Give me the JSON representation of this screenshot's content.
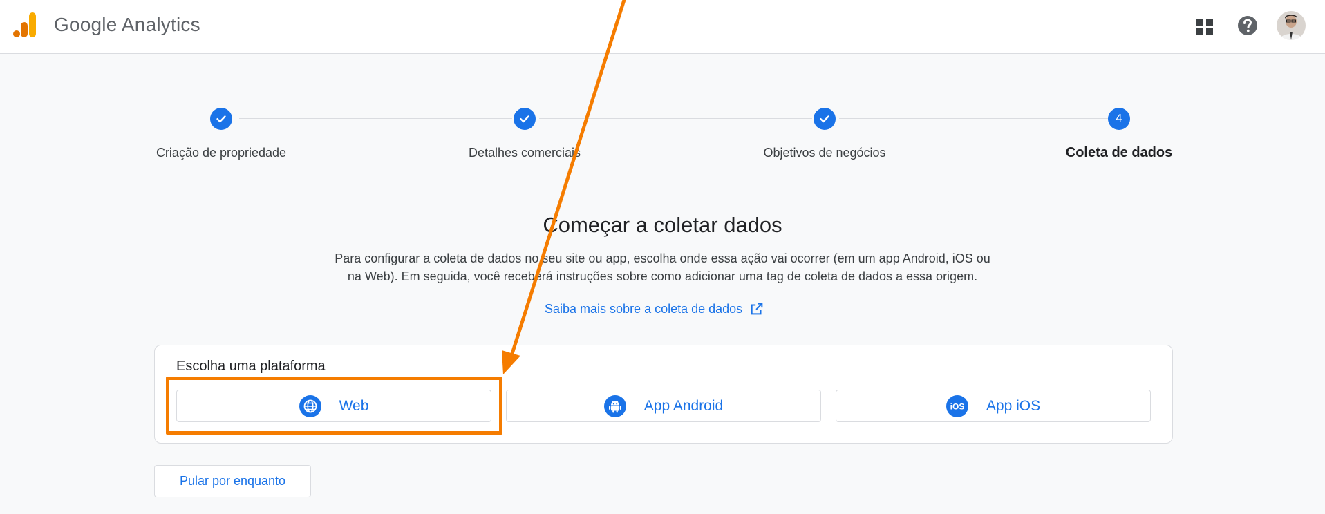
{
  "header": {
    "brand": "Google Analytics",
    "icons": [
      "apps-grid-icon",
      "help-icon",
      "account-avatar"
    ]
  },
  "stepper": {
    "steps": [
      {
        "label": "Criação de propriedade",
        "state": "done"
      },
      {
        "label": "Detalhes comerciais",
        "state": "done"
      },
      {
        "label": "Objetivos de negócios",
        "state": "done"
      },
      {
        "label": "Coleta de dados",
        "state": "current",
        "number": "4"
      }
    ]
  },
  "main": {
    "title": "Começar a coletar dados",
    "description_line1": "Para configurar a coleta de dados no seu site ou app, escolha onde essa ação vai ocorrer (em um app Android, iOS ou",
    "description_line2": "na Web). Em seguida, você receberá instruções sobre como adicionar uma tag de coleta de dados a essa origem.",
    "learn_more": "Saiba mais sobre a coleta de dados"
  },
  "platforms": {
    "title": "Escolha uma plataforma",
    "options": [
      {
        "label": "Web",
        "icon": "globe-icon"
      },
      {
        "label": "App Android",
        "icon": "android-icon"
      },
      {
        "label": "App iOS",
        "icon": "ios-icon"
      }
    ]
  },
  "skip_label": "Pular por enquanto",
  "colors": {
    "accent": "#1a73e8",
    "annotation": "#f57c00",
    "logo_orange": "#f9ab00",
    "logo_dark_orange": "#e37400"
  }
}
